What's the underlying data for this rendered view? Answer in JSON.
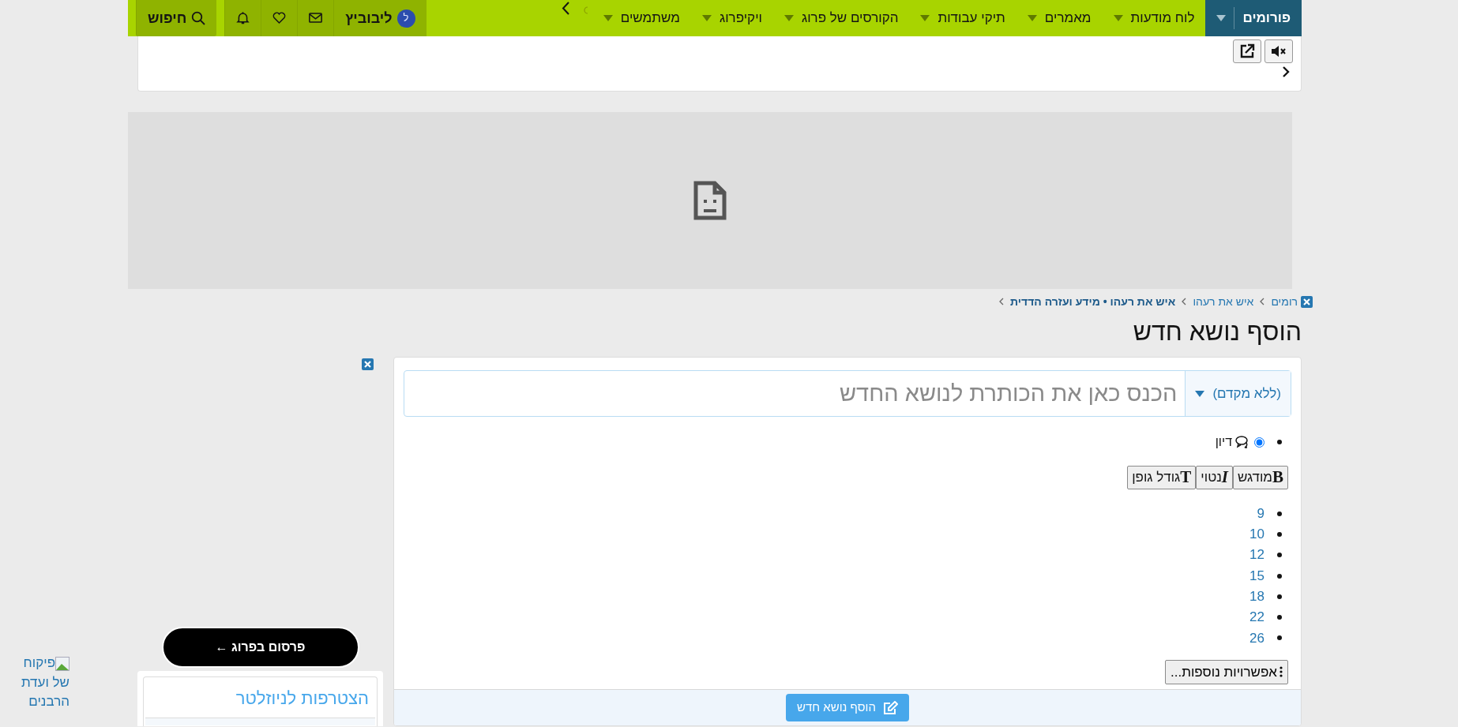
{
  "nav": {
    "items": [
      {
        "label": "פורומים",
        "selected": true
      },
      {
        "label": "לוח מודעות",
        "selected": false
      },
      {
        "label": "מאמרים",
        "selected": false
      },
      {
        "label": "תיקי עבודות",
        "selected": false
      },
      {
        "label": "הקורסים של פרוג",
        "selected": false
      },
      {
        "label": "ויקיפרוג",
        "selected": false
      },
      {
        "label": "משתמשים",
        "selected": false
      }
    ],
    "user": {
      "avatar_letter": "ל",
      "name": "ליבוביץ"
    },
    "search_label": "חיפוש"
  },
  "breadcrumb": [
    {
      "label": "רומים",
      "bold": false
    },
    {
      "label": "איש את רעהו",
      "bold": false
    },
    {
      "label": "איש את רעהו • מידע ועזרה הדדית",
      "bold": true
    }
  ],
  "title": "הוסף נושא חדש",
  "form": {
    "prefix": "(ללא מקדם)",
    "title_placeholder": "הכנס כאן את הכותרת לנושא החדש",
    "thread_types": [
      {
        "label": "דיון",
        "selected": true
      }
    ],
    "format_buttons": [
      {
        "kind": "bold",
        "glyph": "B",
        "label": "מודגש"
      },
      {
        "kind": "italic",
        "glyph": "I",
        "label": "נטוי"
      },
      {
        "kind": "size",
        "glyph": "T",
        "label": "גודל גופן"
      }
    ],
    "font_sizes": [
      "9",
      "10",
      "12",
      "15",
      "18",
      "22",
      "26"
    ],
    "more_options": "אפשרויות נוספות...",
    "submit": "הוסף נושא חדש"
  },
  "sidebar": {
    "promo_button": "פרסום בפרוג ←",
    "newsletter_title": "הצטרפות לניוזלטר"
  },
  "side_link": "פיקוח של ועדת הרבנים"
}
